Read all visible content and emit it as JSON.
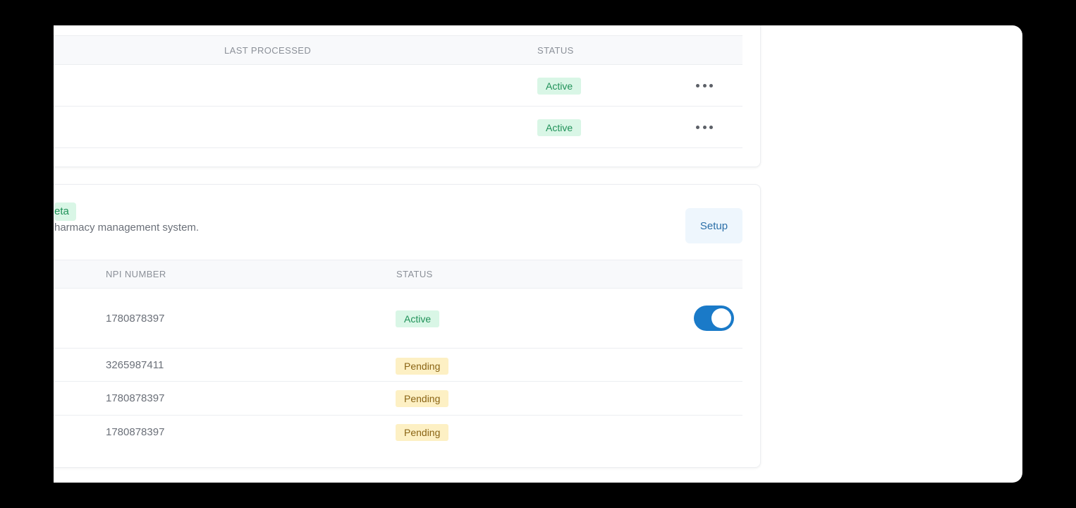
{
  "top_table": {
    "headers": {
      "last_processed": "LAST PROCESSED",
      "status": "STATUS"
    },
    "rows": [
      {
        "status": "Active"
      },
      {
        "status": "Active"
      }
    ]
  },
  "integration": {
    "badge": "eta",
    "description": "harmacy management system.",
    "setup_label": "Setup",
    "headers": {
      "npi": "NPI NUMBER",
      "status": "STATUS"
    },
    "rows": [
      {
        "npi": "1780878397",
        "status": "Active",
        "toggle_on": true
      },
      {
        "npi": "3265987411",
        "status": "Pending"
      },
      {
        "npi": "1780878397",
        "status": "Pending"
      },
      {
        "npi": "1780878397",
        "status": "Pending"
      }
    ]
  },
  "colors": {
    "accent": "#1a7ac8",
    "active_bg": "#d9f6e6",
    "active_text": "#1f9158",
    "pending_bg": "#fdf0c4",
    "pending_text": "#8a6414"
  },
  "icons": [
    "more-horizontal-icon"
  ]
}
